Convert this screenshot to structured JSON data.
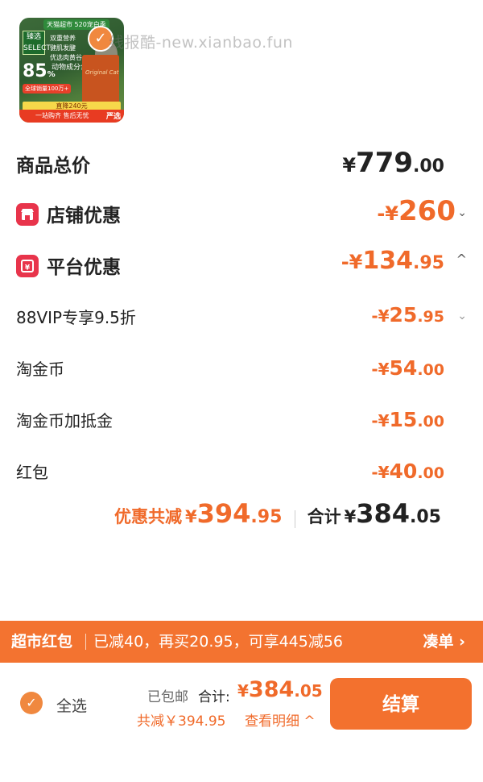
{
  "product": {
    "store_badge": "天猫超市 520宠白季",
    "brand_box": "臻选 SELECT",
    "features": [
      "双重营养",
      "健肌发腱",
      "优选肉黄谷"
    ],
    "percent": "85",
    "percent_unit": "%",
    "percent_desc": "动物成分含量",
    "percent_sub": "全球销量100万+",
    "bag_text": "Original Cat",
    "drop_text": "直降240元",
    "bottom_bar": "一站购齐 售后无忧",
    "corner_label": "严选"
  },
  "watermark": "线报酷-new.xianbao.fun",
  "rows": {
    "goods_total": {
      "label": "商品总价",
      "yen": "¥",
      "int": "779",
      "dec": ".00"
    },
    "store_discount": {
      "label": "店铺优惠",
      "yen": "-¥",
      "int": "260",
      "dec": ""
    },
    "platform_discount": {
      "label": "平台优惠",
      "yen": "-¥",
      "int": "134",
      "dec": ".95"
    },
    "vip": {
      "label": "88VIP专享9.5折",
      "yen": "-¥",
      "int": "25",
      "dec": ".95"
    },
    "coins": {
      "label": "淘金币",
      "yen": "-¥",
      "int": "54",
      "dec": ".00"
    },
    "coins_extra": {
      "label": "淘金币加抵金",
      "yen": "-¥",
      "int": "15",
      "dec": ".00"
    },
    "red_packet": {
      "label": "红包",
      "yen": "-¥",
      "int": "40",
      "dec": ".00"
    }
  },
  "summary": {
    "save_label": "优惠共减",
    "save_yen": "¥",
    "save_int": "394",
    "save_dec": ".95",
    "total_label": "合计",
    "total_yen": "¥",
    "total_int": "384",
    "total_dec": ".05"
  },
  "banner": {
    "label": "超市红包",
    "text": "已减40，再买20.95，可享445减56",
    "link": "凑单 ›"
  },
  "bottom": {
    "select_all": "全选",
    "shipped": "已包邮",
    "total_label": "合计:",
    "total_yen": "¥",
    "total_int": "384",
    "total_dec": ".05",
    "saved": "共减￥394.95",
    "detail": "查看明细 ^",
    "checkout": "结算"
  },
  "icons": {
    "store": "storefront-icon",
    "platform": "coupon-icon",
    "check": "checkmark-icon"
  },
  "colors": {
    "accent": "#f06a2a",
    "banner": "#f37330",
    "icon_red": "#e8344b",
    "checkout": "#f3712e"
  }
}
